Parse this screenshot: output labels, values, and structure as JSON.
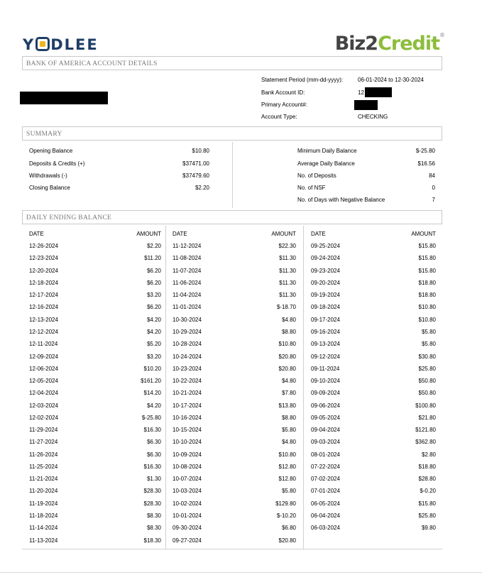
{
  "header": {
    "left_logo": "YODLEE",
    "right_logo_a": "Biz2",
    "right_logo_b": "Credit",
    "right_logo_mark": "®"
  },
  "account_section": {
    "title": "BANK OF AMERICA ACCOUNT DETAILS",
    "statement_period_label": "Statement Period (mm-dd-yyyy):",
    "statement_period_value": "06-01-2024 to 12-30-2024",
    "bank_account_id_label": "Bank Account ID:",
    "bank_account_id_value": "12",
    "primary_account_label": "Primary Account#:",
    "account_type_label": "Account Type:",
    "account_type_value": "CHECKING"
  },
  "summary": {
    "title": "SUMMARY",
    "left": [
      {
        "label": "Opening Balance",
        "value": "$10.80"
      },
      {
        "label": "Deposits & Credits (+)",
        "value": "$37471.00"
      },
      {
        "label": "Withdrawals (-)",
        "value": "$37479.60"
      },
      {
        "label": "Closing Balance",
        "value": "$2.20"
      }
    ],
    "right": [
      {
        "label": "Minimum Daily Balance",
        "value": "$-25.80"
      },
      {
        "label": "Average Daily Balance",
        "value": "$16.56"
      },
      {
        "label": "No. of Deposits",
        "value": "84"
      },
      {
        "label": "No. of NSF",
        "value": "0"
      },
      {
        "label": "No. of Days with Negative Balance",
        "value": "7"
      }
    ]
  },
  "daily": {
    "title": "DAILY ENDING BALANCE",
    "date_header": "DATE",
    "amount_header": "AMOUNT",
    "columns": [
      [
        [
          "12-26-2024",
          "$2.20"
        ],
        [
          "12-23-2024",
          "$11.20"
        ],
        [
          "12-20-2024",
          "$6.20"
        ],
        [
          "12-18-2024",
          "$6.20"
        ],
        [
          "12-17-2024",
          "$3.20"
        ],
        [
          "12-16-2024",
          "$6.20"
        ],
        [
          "12-13-2024",
          "$4.20"
        ],
        [
          "12-12-2024",
          "$4.20"
        ],
        [
          "12-11-2024",
          "$5.20"
        ],
        [
          "12-09-2024",
          "$3.20"
        ],
        [
          "12-06-2024",
          "$10.20"
        ],
        [
          "12-05-2024",
          "$161.20"
        ],
        [
          "12-04-2024",
          "$14.20"
        ],
        [
          "12-03-2024",
          "$4.20"
        ],
        [
          "12-02-2024",
          "$-25.80"
        ],
        [
          "11-29-2024",
          "$16.30"
        ],
        [
          "11-27-2024",
          "$6.30"
        ],
        [
          "11-26-2024",
          "$6.30"
        ],
        [
          "11-25-2024",
          "$16.30"
        ],
        [
          "11-21-2024",
          "$1.30"
        ],
        [
          "11-20-2024",
          "$28.30"
        ],
        [
          "11-19-2024",
          "$28.30"
        ],
        [
          "11-18-2024",
          "$8.30"
        ],
        [
          "11-14-2024",
          "$8.30"
        ],
        [
          "11-13-2024",
          "$18.30"
        ]
      ],
      [
        [
          "11-12-2024",
          "$22.30"
        ],
        [
          "11-08-2024",
          "$11.30"
        ],
        [
          "11-07-2024",
          "$11.30"
        ],
        [
          "11-06-2024",
          "$11.30"
        ],
        [
          "11-04-2024",
          "$11.30"
        ],
        [
          "11-01-2024",
          "$-18.70"
        ],
        [
          "10-30-2024",
          "$4.80"
        ],
        [
          "10-29-2024",
          "$8.80"
        ],
        [
          "10-28-2024",
          "$10.80"
        ],
        [
          "10-24-2024",
          "$20.80"
        ],
        [
          "10-23-2024",
          "$20.80"
        ],
        [
          "10-22-2024",
          "$4.80"
        ],
        [
          "10-21-2024",
          "$7.80"
        ],
        [
          "10-17-2024",
          "$13.80"
        ],
        [
          "10-16-2024",
          "$8.80"
        ],
        [
          "10-15-2024",
          "$5.80"
        ],
        [
          "10-10-2024",
          "$4.80"
        ],
        [
          "10-09-2024",
          "$10.80"
        ],
        [
          "10-08-2024",
          "$12.80"
        ],
        [
          "10-07-2024",
          "$12.80"
        ],
        [
          "10-03-2024",
          "$5.80"
        ],
        [
          "10-02-2024",
          "$129.80"
        ],
        [
          "10-01-2024",
          "$-10.20"
        ],
        [
          "09-30-2024",
          "$6.80"
        ],
        [
          "09-27-2024",
          "$20.80"
        ]
      ],
      [
        [
          "09-25-2024",
          "$15.80"
        ],
        [
          "09-24-2024",
          "$15.80"
        ],
        [
          "09-23-2024",
          "$15.80"
        ],
        [
          "09-20-2024",
          "$18.80"
        ],
        [
          "09-19-2024",
          "$18.80"
        ],
        [
          "09-18-2024",
          "$10.80"
        ],
        [
          "09-17-2024",
          "$10.80"
        ],
        [
          "09-16-2024",
          "$5.80"
        ],
        [
          "09-13-2024",
          "$5.80"
        ],
        [
          "09-12-2024",
          "$30.80"
        ],
        [
          "09-11-2024",
          "$25.80"
        ],
        [
          "09-10-2024",
          "$50.80"
        ],
        [
          "09-09-2024",
          "$50.80"
        ],
        [
          "09-06-2024",
          "$100.80"
        ],
        [
          "09-05-2024",
          "$21.80"
        ],
        [
          "09-04-2024",
          "$121.80"
        ],
        [
          "09-03-2024",
          "$362.80"
        ],
        [
          "08-01-2024",
          "$2.80"
        ],
        [
          "07-22-2024",
          "$18.80"
        ],
        [
          "07-02-2024",
          "$28.80"
        ],
        [
          "07-01-2024",
          "$-0.20"
        ],
        [
          "06-05-2024",
          "$15.80"
        ],
        [
          "06-04-2024",
          "$25.80"
        ],
        [
          "06-03-2024",
          "$9.80"
        ]
      ]
    ]
  }
}
